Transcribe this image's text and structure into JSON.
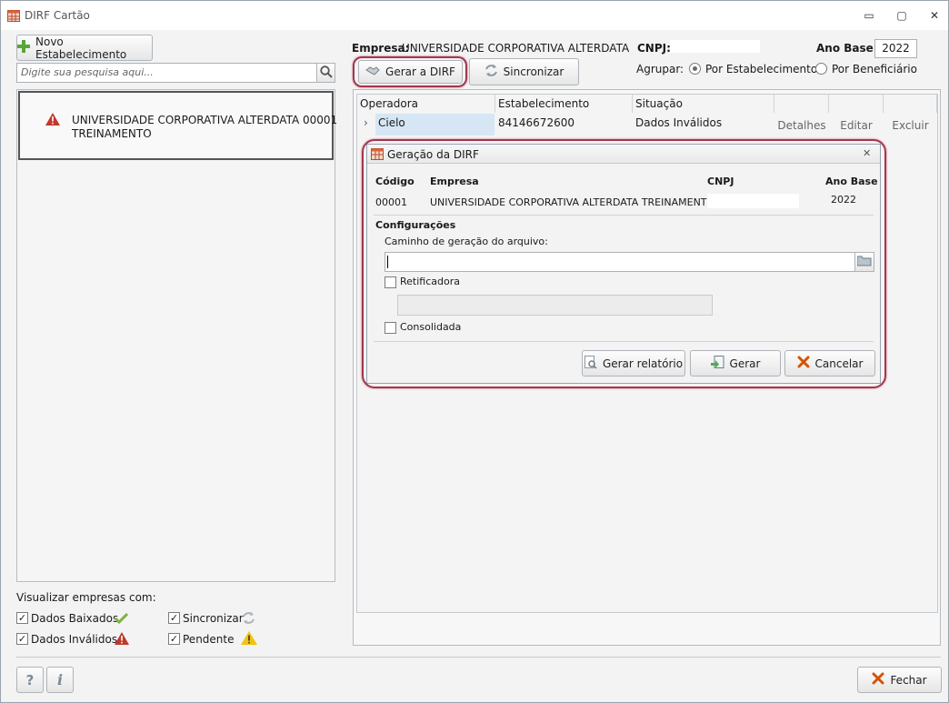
{
  "window": {
    "title": "DIRF Cartão",
    "icon": "grid-app-icon",
    "controls": {
      "minimize": "▭",
      "restore": "▢",
      "close": "✕"
    }
  },
  "sidebar": {
    "new_button_label": "Novo Estabelecimento",
    "search_placeholder": "Digite sua pesquisa aqui...",
    "items": [
      {
        "name": "UNIVERSIDADE CORPORATIVA ALTERDATA  00001",
        "name2": "TREINAMENTO",
        "status": "warning-icon"
      }
    ]
  },
  "filters": {
    "title": "Visualizar empresas com:",
    "items": [
      {
        "label": "Dados Baixados",
        "checked": true,
        "icon": "check-icon"
      },
      {
        "label": "Sincronizar",
        "checked": true,
        "icon": "sync-icon"
      },
      {
        "label": "Dados Inválidos",
        "checked": true,
        "icon": "error-triangle-icon"
      },
      {
        "label": "Pendente",
        "checked": true,
        "icon": "warning-triangle-icon"
      }
    ]
  },
  "header": {
    "empresa_label": "Empresa:",
    "empresa_value": "UNIVERSIDADE CORPORATIVA ALTERDATA TRE",
    "cnpj_label": "CNPJ:",
    "cnpj_value": "",
    "ano_base_label": "Ano Base:",
    "ano_base_value": "2022",
    "gerar_label": "Gerar a DIRF",
    "sincronizar_label": "Sincronizar",
    "agrupar_label": "Agrupar:",
    "group_options": [
      {
        "label": "Por Estabelecimento",
        "selected": true
      },
      {
        "label": "Por Beneficiário",
        "selected": false
      }
    ]
  },
  "grid": {
    "columns": [
      "Operadora",
      "Estabelecimento",
      "Situação"
    ],
    "rows": [
      {
        "operadora": "Cielo",
        "estabelecimento": "84146672600",
        "situacao": "Dados Inválidos",
        "actions": [
          "Detalhes",
          "Editar",
          "Excluir"
        ]
      }
    ]
  },
  "dialog": {
    "title": "Geração da DIRF",
    "columns": {
      "codigo": "Código",
      "empresa": "Empresa",
      "cnpj": "CNPJ",
      "ano_base": "Ano Base"
    },
    "row": {
      "codigo": "00001",
      "empresa": "UNIVERSIDADE CORPORATIVA ALTERDATA TREINAMENTO",
      "cnpj": "",
      "ano_base": "2022"
    },
    "config_title": "Configurações",
    "path_label": "Caminho de geração do arquivo:",
    "path_value": "",
    "retificadora_label": "Retificadora",
    "retificadora_checked": false,
    "consolidada_label": "Consolidada",
    "consolidada_checked": false,
    "buttons": {
      "relatorio": "Gerar relatório",
      "gerar": "Gerar",
      "cancelar": "Cancelar"
    }
  },
  "footer": {
    "help_label": "?",
    "info_label": "i",
    "close_label": "Fechar"
  },
  "colors": {
    "highlight": "#a3364f",
    "selection": "#d6e6f5",
    "warning_red": "#c0392b",
    "warning_yellow": "#f1c40f",
    "ok_green": "#7cb342"
  }
}
